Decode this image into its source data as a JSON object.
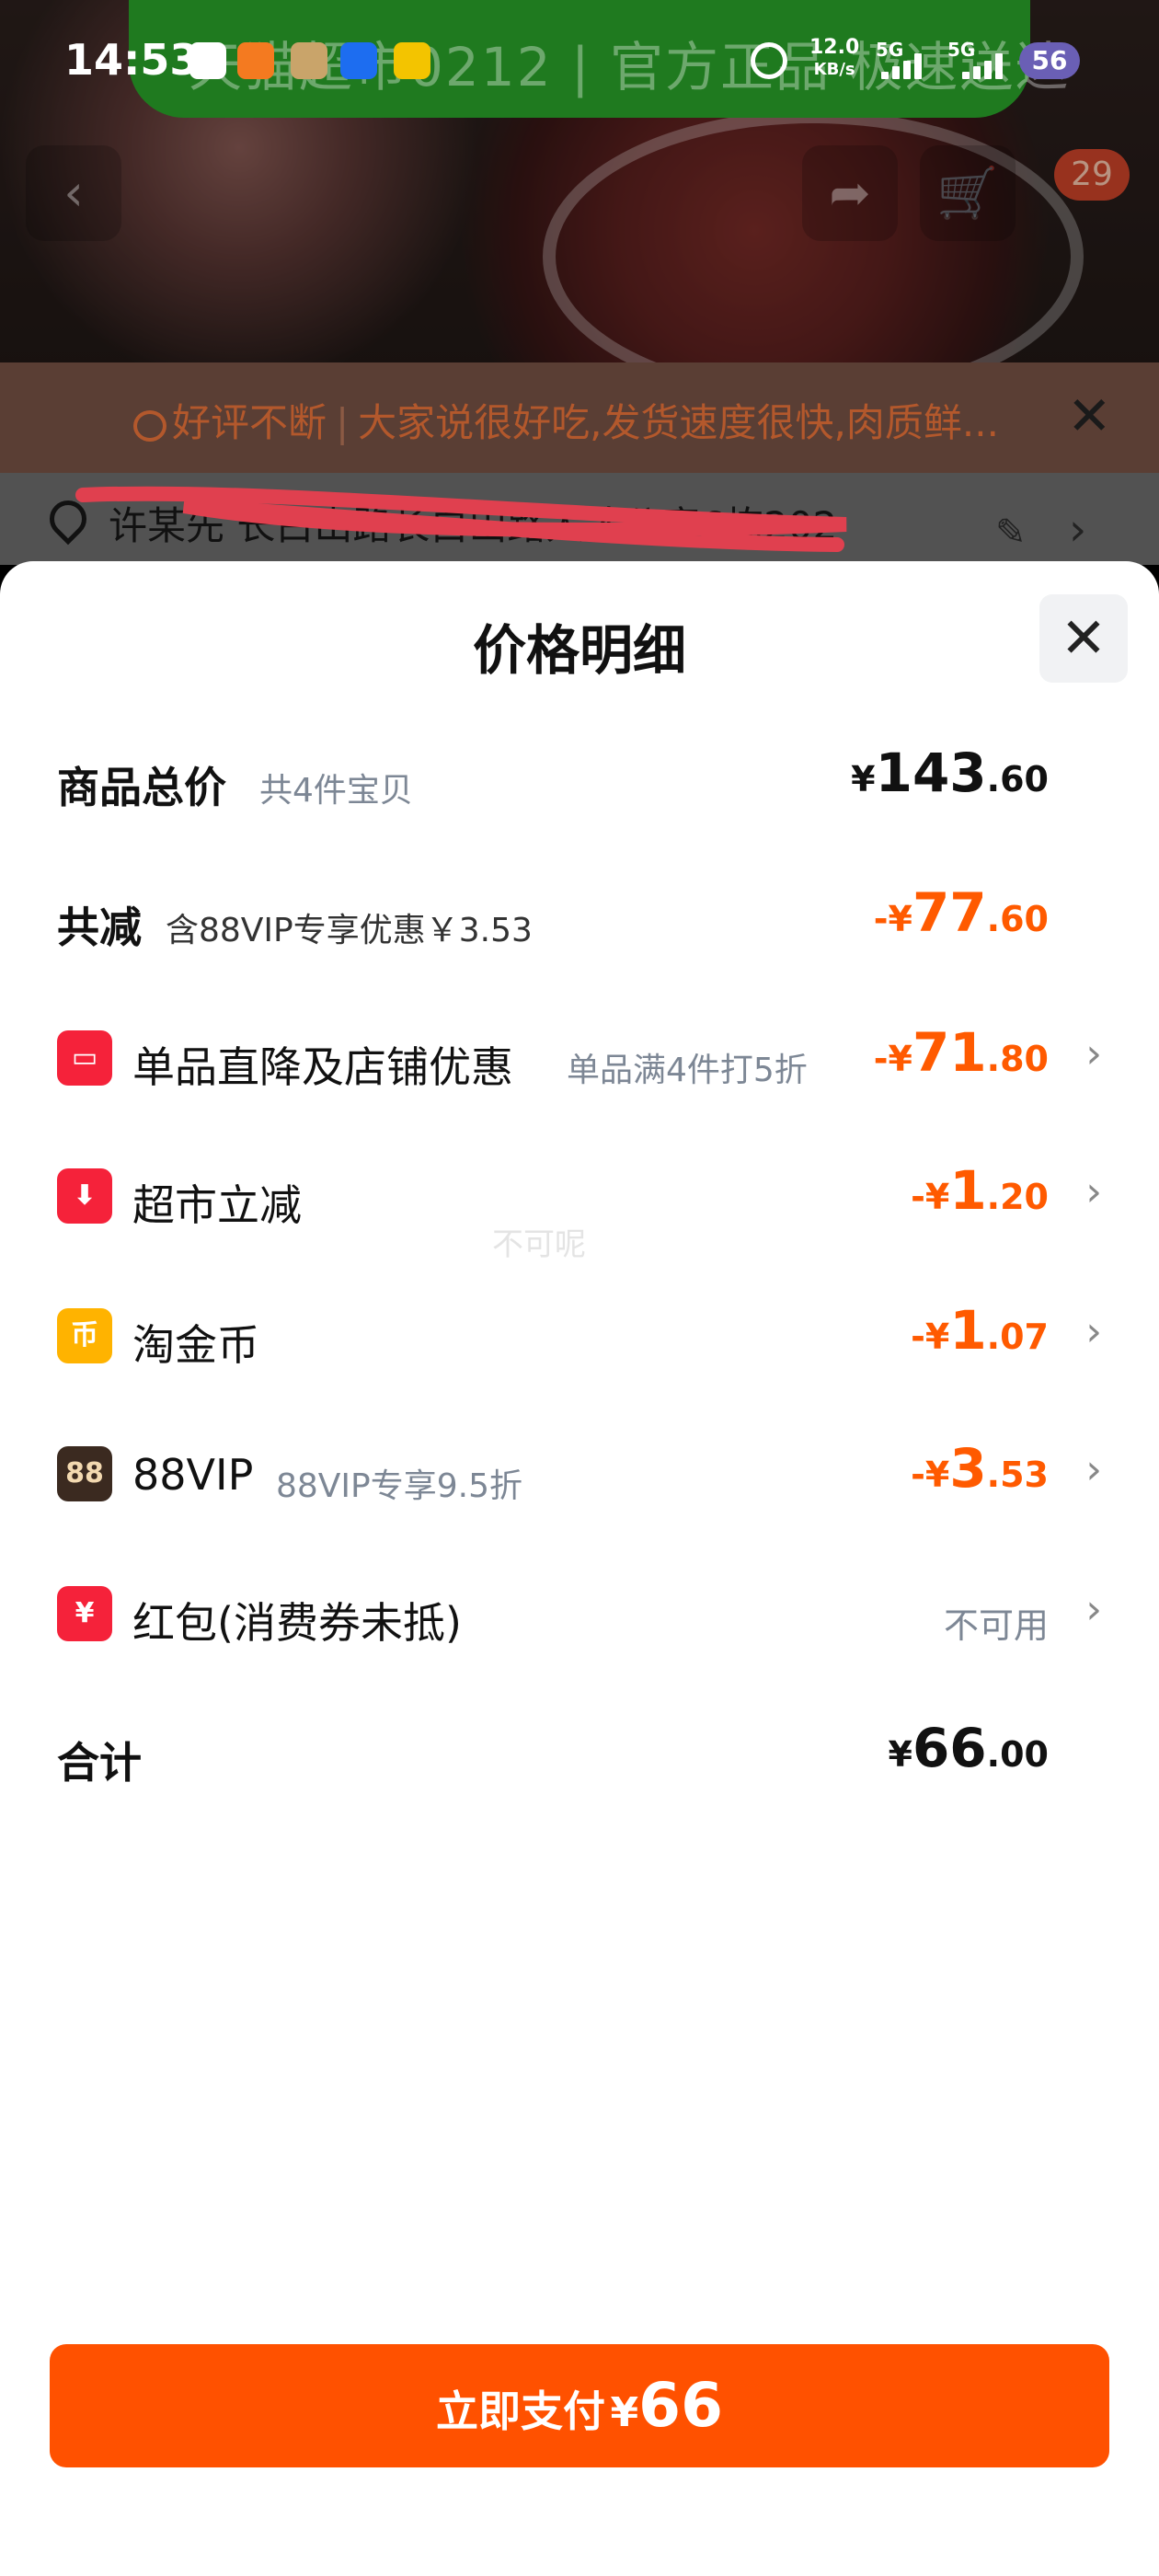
{
  "status_bar": {
    "time": "14:53",
    "net_speed_value": "12.0",
    "net_speed_unit": "KB/s",
    "signal_1": "5G",
    "signal_2": "5G",
    "battery": "56"
  },
  "banner": {
    "text": "天猫超市0212 | 官方正品 极速送达"
  },
  "top_nav": {
    "cart_count": "29"
  },
  "review": {
    "label": "好评不断",
    "text": "大家说很好吃,发货速度很快,肉质鲜..."
  },
  "address": {
    "text": "许某先 长白山路长白山路人才公寓6栋202"
  },
  "sheet": {
    "title": "价格明细",
    "rows": {
      "total": {
        "label": "商品总价",
        "sub": "共4件宝贝",
        "currency": "¥",
        "int": "143",
        "dec": ".60"
      },
      "reduce": {
        "label": "共减",
        "sub": "含88VIP专享优惠￥3.53",
        "currency": "-¥",
        "int": "77",
        "dec": ".60"
      },
      "shop": {
        "label": "单品直降及店铺优惠",
        "sub": "单品满4件打5折",
        "currency": "-¥",
        "int": "71",
        "dec": ".80"
      },
      "market": {
        "label": "超市立减",
        "currency": "-¥",
        "int": "1",
        "dec": ".20"
      },
      "coin": {
        "label": "淘金币",
        "icon_text": "币",
        "currency": "-¥",
        "int": "1",
        "dec": ".07"
      },
      "vip": {
        "label": "88VIP",
        "icon_text": "88",
        "sub": "88VIP专享9.5折",
        "currency": "-¥",
        "int": "3",
        "dec": ".53"
      },
      "redpacket": {
        "label": "红包(消费券未抵)",
        "icon_text": "¥",
        "status": "不可用"
      },
      "sum": {
        "label": "合计",
        "currency": "¥",
        "int": "66",
        "dec": ".00"
      }
    },
    "watermark": "不可呢"
  },
  "pay_button": {
    "label": "立即支付",
    "currency": "¥",
    "amount": "66"
  },
  "colors": {
    "accent": "#ff5100",
    "discount": "#ff5a00",
    "icon_red": "#f5223a",
    "icon_yellow": "#ffb300",
    "icon_brown": "#3b2a20"
  },
  "icons": [
    "wechat-icon",
    "alarm-icon",
    "back-icon",
    "share-icon",
    "cart-icon",
    "chat-bubble-icon",
    "close-icon",
    "location-pin-icon",
    "edit-icon",
    "chevron-right-icon",
    "shop-icon",
    "down-arrow-icon",
    "coin-icon",
    "vip-icon",
    "red-packet-icon"
  ]
}
